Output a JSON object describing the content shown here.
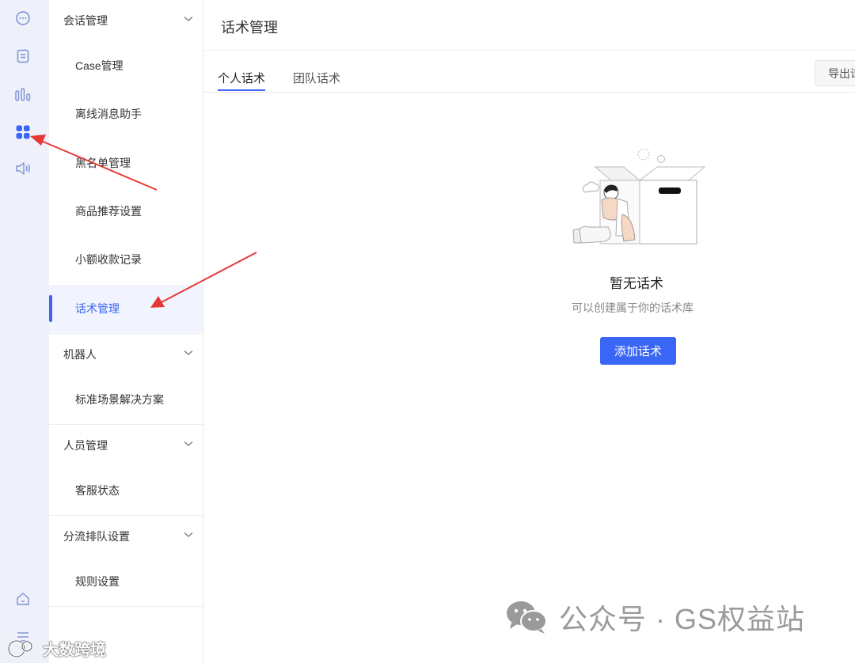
{
  "rail": {
    "icons": [
      "chat-icon",
      "document-icon",
      "bar-chart-icon",
      "apps-grid-icon",
      "speaker-icon",
      "home-icon",
      "list-icon"
    ],
    "accent": "#3a66f5"
  },
  "sidebar": {
    "groups": [
      {
        "label": "会话管理",
        "items": [
          "Case管理",
          "离线消息助手",
          "黑名单管理",
          "商品推荐设置",
          "小额收款记录",
          "话术管理"
        ]
      },
      {
        "label": "机器人",
        "items": [
          "标准场景解决方案"
        ]
      },
      {
        "label": "人员管理",
        "items": [
          "客服状态"
        ]
      },
      {
        "label": "分流排队设置",
        "items": [
          "规则设置"
        ]
      }
    ],
    "active_item": "话术管理"
  },
  "main": {
    "title": "话术管理",
    "tabs": [
      {
        "label": "个人话术",
        "active": true
      },
      {
        "label": "团队话术",
        "active": false
      }
    ],
    "export_label": "导出话",
    "empty": {
      "title": "暂无话术",
      "subtitle": "可以创建属于你的话术库",
      "button": "添加话术"
    }
  },
  "watermark": {
    "text": "公众号 · GS权益站",
    "bottom_text": "大数跨境"
  },
  "colors": {
    "accent": "#3a66f5",
    "rail_bg": "#eef1f9",
    "active_bg": "#f1f4fe",
    "annotation": "#e53935"
  }
}
